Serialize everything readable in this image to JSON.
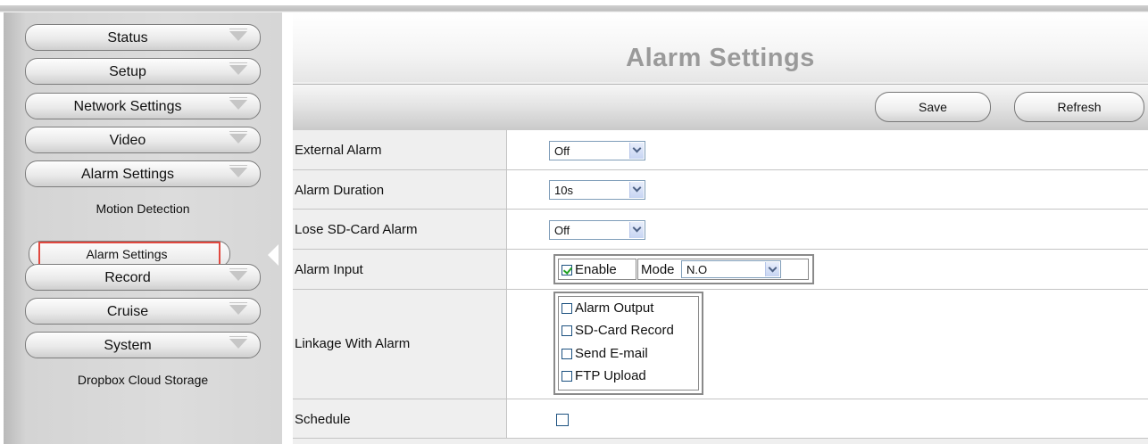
{
  "sidebar": {
    "menu": [
      {
        "label": "Status"
      },
      {
        "label": "Setup"
      },
      {
        "label": "Network Settings"
      },
      {
        "label": "Video"
      },
      {
        "label": "Alarm Settings"
      }
    ],
    "alarm_sub": {
      "motion": "Motion Detection",
      "active": "Alarm Settings"
    },
    "menu2": [
      {
        "label": "Record"
      },
      {
        "label": "Cruise"
      },
      {
        "label": "System"
      }
    ],
    "system_sub": "Dropbox Cloud Storage"
  },
  "page": {
    "title": "Alarm Settings",
    "save_label": "Save",
    "refresh_label": "Refresh"
  },
  "form": {
    "external_alarm": {
      "label": "External Alarm",
      "value": "Off"
    },
    "alarm_duration": {
      "label": "Alarm Duration",
      "value": "10s"
    },
    "lose_sd": {
      "label": "Lose SD-Card Alarm",
      "value": "Off"
    },
    "alarm_input": {
      "label": "Alarm Input",
      "enable_label": "Enable",
      "enable_checked": true,
      "mode_label": "Mode",
      "mode_value": "N.O"
    },
    "linkage": {
      "label": "Linkage With Alarm",
      "options": [
        {
          "label": "Alarm Output",
          "checked": false
        },
        {
          "label": "SD-Card Record",
          "checked": false
        },
        {
          "label": "Send E-mail",
          "checked": false
        },
        {
          "label": "FTP Upload",
          "checked": false
        }
      ]
    },
    "schedule": {
      "label": "Schedule",
      "checked": false
    }
  }
}
